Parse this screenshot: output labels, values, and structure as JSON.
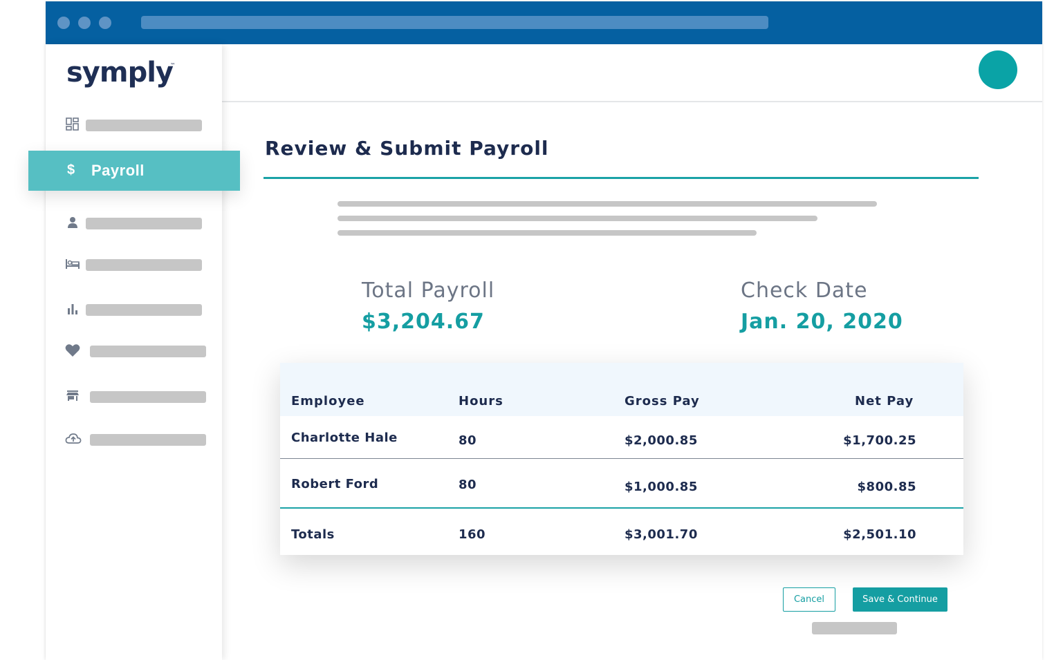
{
  "app": {
    "logo_text": "symply",
    "logo_tm": "™"
  },
  "sidebar": {
    "active_item": {
      "icon": "dollar-icon",
      "label": "Payroll"
    },
    "items": [
      {
        "icon": "dashboard-icon"
      },
      {
        "icon": "person-icon"
      },
      {
        "icon": "bed-icon"
      },
      {
        "icon": "bar-chart-icon"
      },
      {
        "icon": "heart-icon"
      },
      {
        "icon": "store-icon"
      },
      {
        "icon": "cloud-upload-icon"
      }
    ]
  },
  "main": {
    "title": "Review & Submit Payroll",
    "total_payroll": {
      "label": "Total Payroll",
      "value": "$3,204.67"
    },
    "check_date": {
      "label": "Check Date",
      "value": "Jan. 20, 2020"
    }
  },
  "table": {
    "headers": [
      "Employee",
      "Hours",
      "Gross Pay",
      "Net Pay"
    ],
    "rows": [
      {
        "employee": "Charlotte Hale",
        "hours": "80",
        "gross": "$2,000.85",
        "net": "$1,700.25"
      },
      {
        "employee": "Robert Ford",
        "hours": "80",
        "gross": "$1,000.85",
        "net": "$800.85"
      }
    ],
    "totals": {
      "label": "Totals",
      "hours": "160",
      "gross": "$3,001.70",
      "net": "$2,501.10"
    }
  },
  "actions": {
    "cancel_label": "Cancel",
    "save_label": "Save & Continue"
  },
  "colors": {
    "titlebar": "#0560a1",
    "accent": "#159ea2",
    "active_nav": "#56bfc3",
    "heading": "#1d2b4e"
  }
}
